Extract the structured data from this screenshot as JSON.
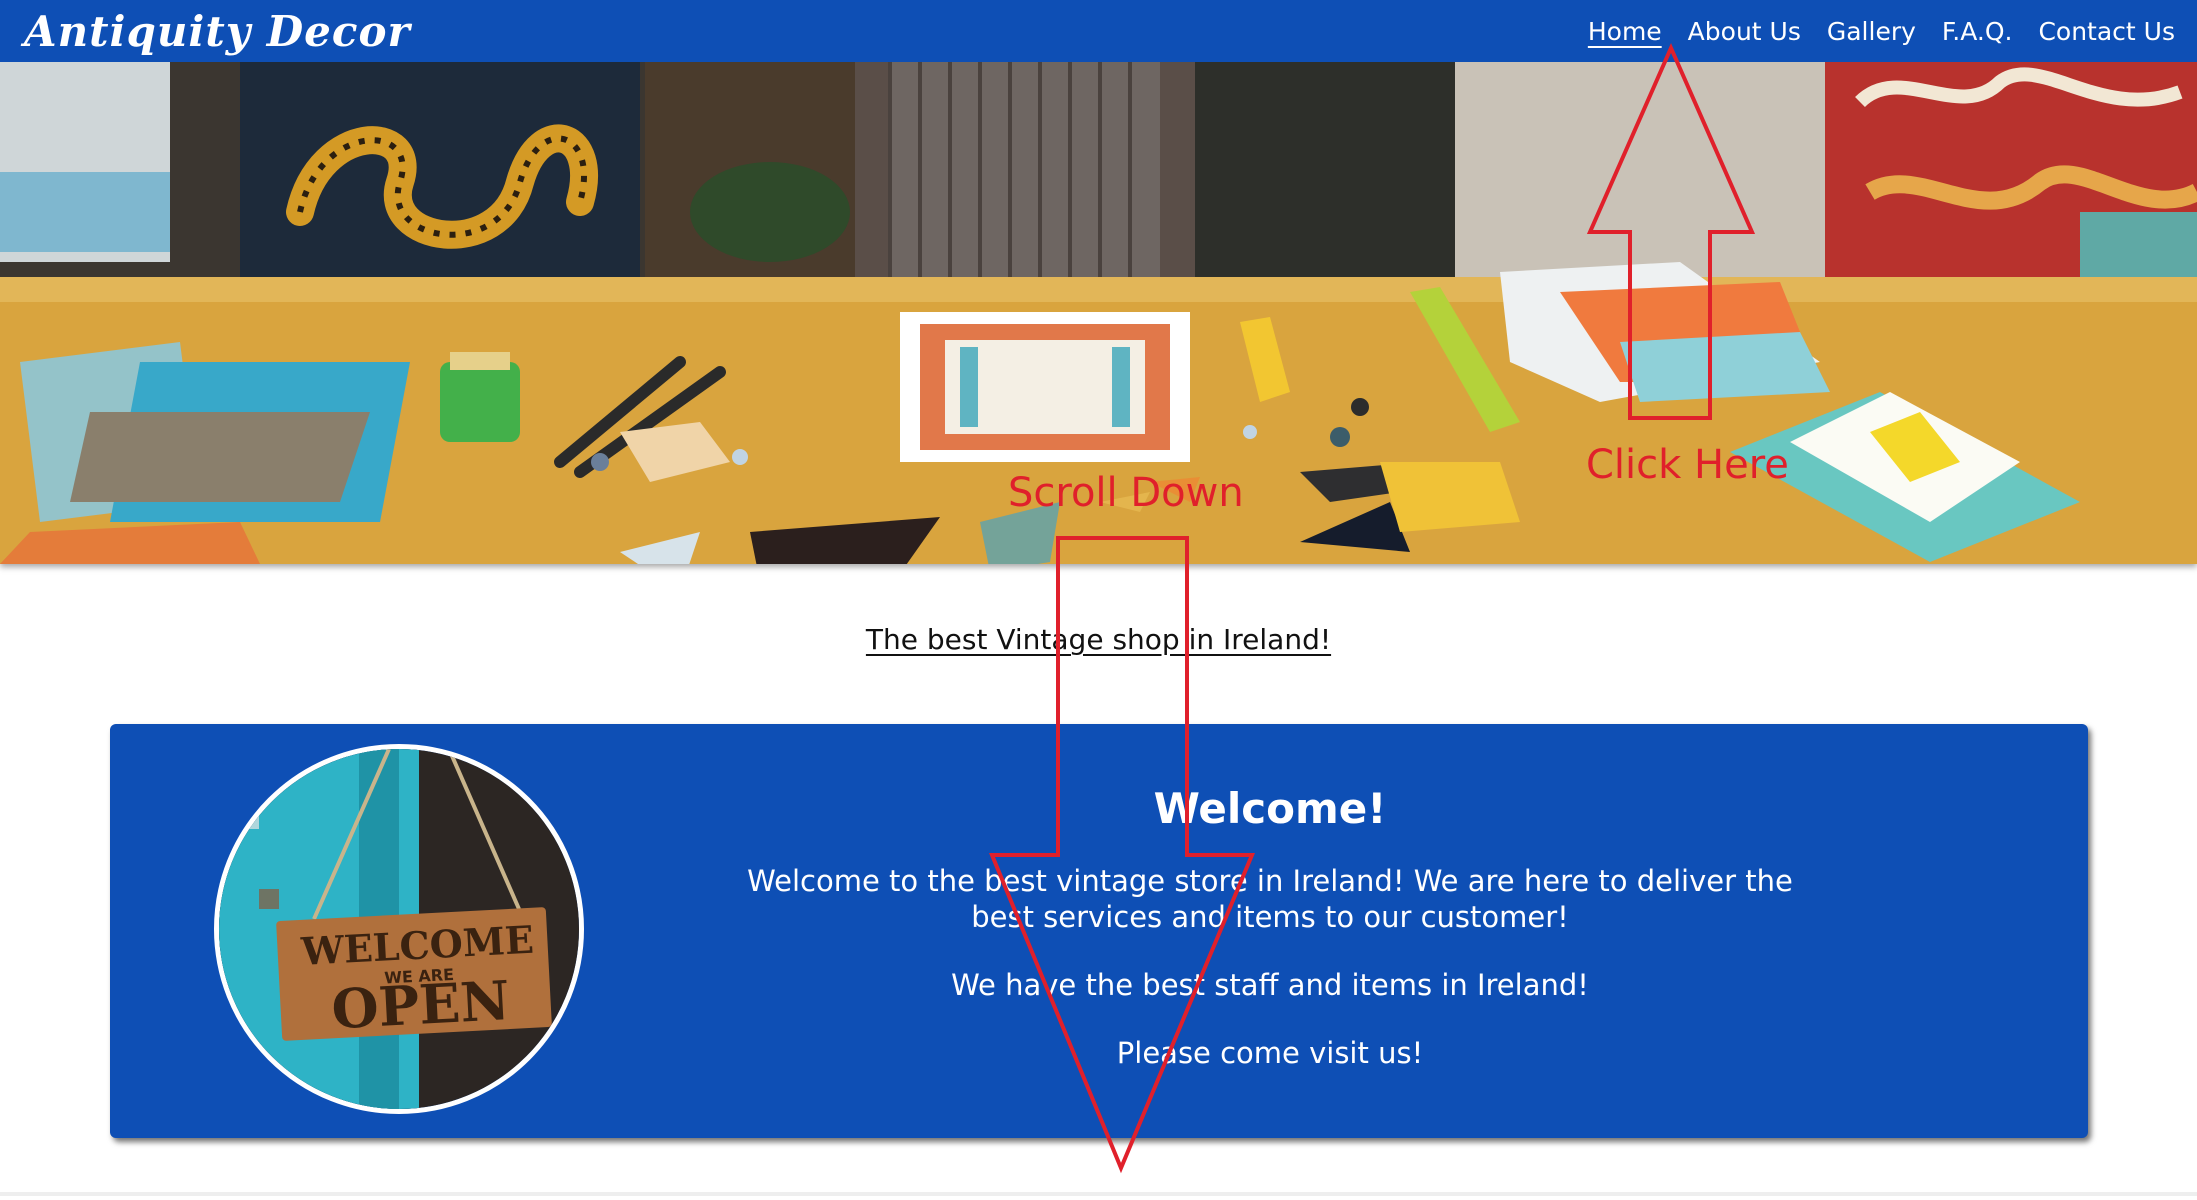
{
  "navbar": {
    "brand": "Antiquity Decor",
    "links": [
      {
        "label": "Home",
        "active": true
      },
      {
        "label": "About Us",
        "active": false
      },
      {
        "label": "Gallery",
        "active": false
      },
      {
        "label": "F.A.Q.",
        "active": false
      },
      {
        "label": "Contact Us",
        "active": false
      }
    ],
    "background_color": "#0e4fb5"
  },
  "hero": {
    "image": "artist workbench with stained glass pieces"
  },
  "tagline": "The best Vintage shop in Ireland!",
  "welcome": {
    "heading": "Welcome!",
    "paragraphs": [
      "Welcome to the best vintage store in Ireland! We are here to deliver the best services and items to our customer!",
      "We have the best staff and items in Ireland!",
      "Please come visit us!"
    ],
    "photo": {
      "sign_line1": "WELCOME",
      "sign_line2": "WE ARE",
      "sign_line3": "OPEN"
    }
  },
  "annotations": {
    "click_here": "Click Here",
    "scroll_down": "Scroll Down",
    "color": "#e0202b"
  }
}
